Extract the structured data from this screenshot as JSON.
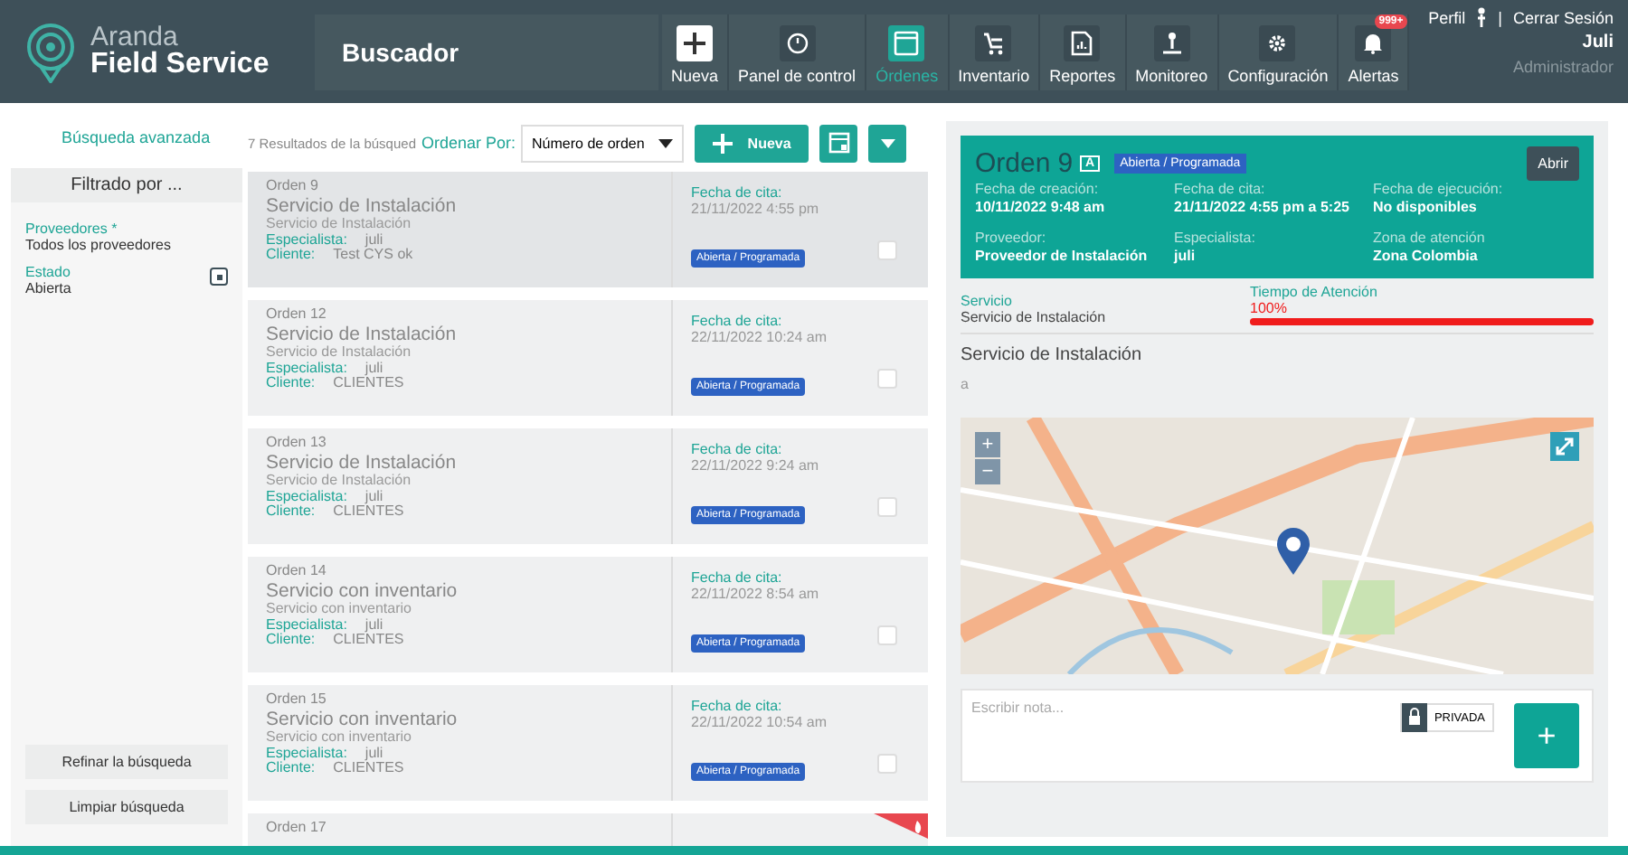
{
  "header": {
    "logo_line1": "Aranda",
    "logo_line2": "Field Service",
    "title": "Buscador",
    "nav": [
      {
        "label": "Nueva",
        "selected": false
      },
      {
        "label": "Panel de control",
        "selected": false
      },
      {
        "label": "Órdenes",
        "selected": true
      },
      {
        "label": "Inventario",
        "selected": false
      },
      {
        "label": "Reportes",
        "selected": false
      },
      {
        "label": "Monitoreo",
        "selected": false
      },
      {
        "label": "Configuración",
        "selected": false
      },
      {
        "label": "Alertas",
        "selected": false,
        "badge": "999+"
      }
    ],
    "profile": "Perfil",
    "separator": "|",
    "logout": "Cerrar Sesión",
    "user": "Juli",
    "role": "Administrador"
  },
  "sidebar": {
    "advanced_search": "Búsqueda avanzada",
    "filter_title": "Filtrado por ...",
    "filters": [
      {
        "label": "Proveedores *",
        "value": "Todos los proveedores",
        "removable": false
      },
      {
        "label": "Estado",
        "value": "Abierta",
        "removable": true
      }
    ],
    "buttons": [
      "Refinar la búsqueda",
      "Limpiar búsqueda"
    ]
  },
  "toolbar": {
    "results": "7 Resultados de la búsqued",
    "sort_label": "Ordenar Por:",
    "sort_value": "Número de orden",
    "new_button": "Nueva"
  },
  "orders": [
    {
      "number": "Orden 9",
      "title": "Servicio de Instalación",
      "subtitle": "Servicio de Instalación",
      "specialist_label": "Especialista:",
      "specialist": "juli",
      "client_label": "Cliente:",
      "client": "Test CYS ok",
      "date_label": "Fecha de cita:",
      "date": "21/11/2022 4:55 pm",
      "status": "Abierta / Programada",
      "selected": true,
      "checked": false,
      "flagged": false
    },
    {
      "number": "Orden 12",
      "title": "Servicio de Instalación",
      "subtitle": "Servicio de Instalación",
      "specialist_label": "Especialista:",
      "specialist": "juli",
      "client_label": "Cliente:",
      "client": "CLIENTES",
      "date_label": "Fecha de cita:",
      "date": "22/11/2022 10:24 am",
      "status": "Abierta / Programada",
      "selected": false,
      "checked": false,
      "flagged": false
    },
    {
      "number": "Orden 13",
      "title": "Servicio de Instalación",
      "subtitle": "Servicio de Instalación",
      "specialist_label": "Especialista:",
      "specialist": "juli",
      "client_label": "Cliente:",
      "client": "CLIENTES",
      "date_label": "Fecha de cita:",
      "date": "22/11/2022 9:24 am",
      "status": "Abierta / Programada",
      "selected": false,
      "checked": false,
      "flagged": false
    },
    {
      "number": "Orden 14",
      "title": "Servicio con inventario",
      "subtitle": "Servicio con inventario",
      "specialist_label": "Especialista:",
      "specialist": "juli",
      "client_label": "Cliente:",
      "client": "CLIENTES",
      "date_label": "Fecha de cita:",
      "date": "22/11/2022 8:54 am",
      "status": "Abierta / Programada",
      "selected": false,
      "checked": false,
      "flagged": false
    },
    {
      "number": "Orden 15",
      "title": "Servicio con inventario",
      "subtitle": "Servicio con inventario",
      "specialist_label": "Especialista:",
      "specialist": "juli",
      "client_label": "Cliente:",
      "client": "CLIENTES",
      "date_label": "Fecha de cita:",
      "date": "22/11/2022 10:54 am",
      "status": "Abierta / Programada",
      "selected": false,
      "checked": false,
      "flagged": false
    },
    {
      "number": "Orden 17",
      "selected": false,
      "flagged": true
    }
  ],
  "detail": {
    "title": "Orden",
    "number": "9",
    "letter": "A",
    "status": "Abierta / Programada",
    "open_button": "Abrir",
    "fields": [
      {
        "label": "Fecha de creación:",
        "value": "10/11/2022 9:48 am"
      },
      {
        "label": "Fecha de cita:",
        "value": "21/11/2022 4:55 pm a 5:25"
      },
      {
        "label": "Fecha de ejecución:",
        "value": "No disponibles"
      },
      {
        "label": "Proveedor:",
        "value": "Proveedor de Instalación"
      },
      {
        "label": "Especialista:",
        "value": "juli"
      },
      {
        "label": "Zona de atención",
        "value": "Zona Colombia"
      }
    ],
    "service_label": "Servicio",
    "service_value": "Servicio de Instalación",
    "time_label": "Tiempo de Atención",
    "time_reading": "100%",
    "level": 1,
    "section_title": "Servicio de Instalación",
    "section_text": "a",
    "map": {
      "zoom_in": "+",
      "zoom_out": "−"
    },
    "note": {
      "placeholder": "Escribir nota...",
      "private_label": "PRIVADA",
      "private": false,
      "add": "+"
    }
  }
}
